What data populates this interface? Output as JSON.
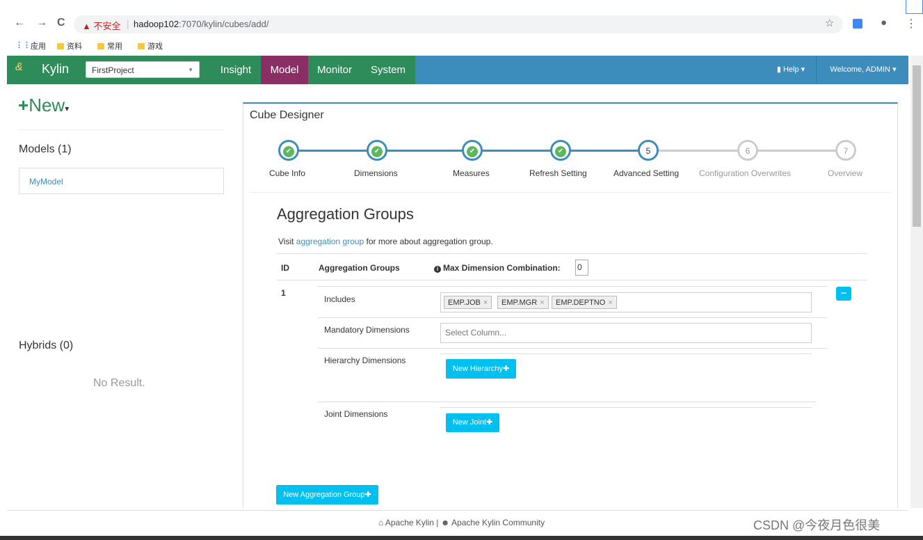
{
  "browser": {
    "back_icon": "←",
    "forward_icon": "→",
    "reload_icon": "C",
    "security_warning": "▲ 不安全",
    "url_host": "hadoop102",
    "url_rest": ":7070/kylin/cubes/add/",
    "bookmarks": [
      {
        "label": "应用"
      },
      {
        "label": "资料"
      },
      {
        "label": "常用"
      },
      {
        "label": "游戏"
      }
    ]
  },
  "header": {
    "brand": "Kylin",
    "brand_logo": "kylin-logo",
    "project": "FirstProject",
    "nav": {
      "insight": "Insight",
      "model": "Model",
      "monitor": "Monitor",
      "system": "System"
    },
    "help": "Help",
    "welcome": "Welcome, ADMIN",
    "colors": {
      "header": "#3c8dbc",
      "brand": "#2e8b5a",
      "model_tab": "#8a2f65"
    }
  },
  "sidebar": {
    "new_label": "New",
    "models_title": "Models (1)",
    "models": [
      "MyModel"
    ],
    "hybrids_title": "Hybrids (0)",
    "no_result": "No Result."
  },
  "designer": {
    "title": "Cube Designer",
    "steps": [
      {
        "label": "Cube Info",
        "state": "done",
        "num": ""
      },
      {
        "label": "Dimensions",
        "state": "done",
        "num": ""
      },
      {
        "label": "Measures",
        "state": "done",
        "num": ""
      },
      {
        "label": "Refresh Setting",
        "state": "done",
        "num": ""
      },
      {
        "label": "Advanced Setting",
        "state": "active",
        "num": "5"
      },
      {
        "label": "Configuration Overwrites",
        "state": "todo",
        "num": "6"
      },
      {
        "label": "Overview",
        "state": "todo",
        "num": "7"
      }
    ],
    "agg": {
      "title": "Aggregation Groups",
      "desc_pre": "Visit ",
      "desc_link": "aggregation group",
      "desc_post": " for more about aggregation group.",
      "col_id": "ID",
      "col_groups": "Aggregation Groups",
      "col_max": "Max Dimension Combination:",
      "max_value": "0",
      "row_id": "1",
      "includes_label": "Includes",
      "includes": [
        "EMP.JOB",
        "EMP.MGR",
        "EMP.DEPTNO"
      ],
      "mandatory_label": "Mandatory Dimensions",
      "mandatory_placeholder": "Select Column...",
      "hierarchy_label": "Hierarchy Dimensions",
      "new_hierarchy": "New Hierarchy✚",
      "joint_label": "Joint Dimensions",
      "new_joint": "New Joint✚",
      "new_group": "New Aggregation Group✚"
    }
  },
  "footer": {
    "text1": "Apache Kylin",
    "sep": "|",
    "text2": "Apache Kylin Community",
    "watermark": "CSDN @今夜月色很美"
  }
}
